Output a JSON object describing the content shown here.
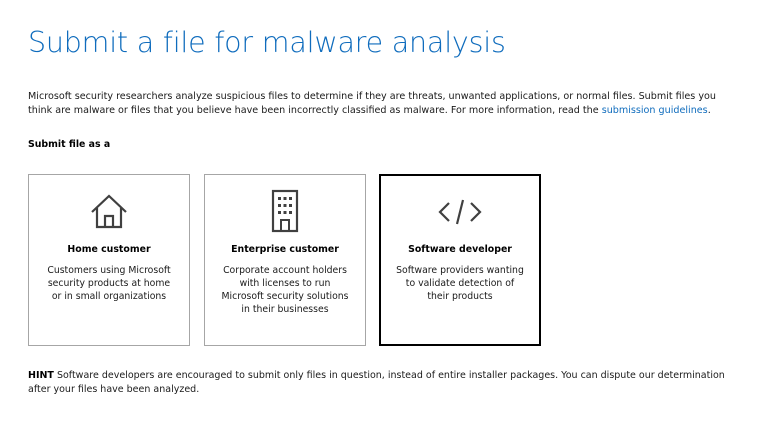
{
  "page": {
    "title": "Submit a file for malware analysis",
    "intro_text": "Microsoft security researchers analyze suspicious files to determine if they are threats, unwanted applications, or normal files. Submit files you think are malware or files that you believe have been incorrectly classified as malware. For more information, read the ",
    "intro_link": "submission guidelines",
    "intro_end": ".",
    "section_label": "Submit file as a"
  },
  "cards": [
    {
      "title": "Home customer",
      "description": "Customers using Microsoft security products at home or in small organizations",
      "icon": "home-icon",
      "selected": false
    },
    {
      "title": "Enterprise customer",
      "description": "Corporate account holders with licenses to run Microsoft security solutions in their businesses",
      "icon": "building-icon",
      "selected": false
    },
    {
      "title": "Software developer",
      "description": "Software providers wanting to validate detection of their products",
      "icon": "code-icon",
      "selected": true
    }
  ],
  "hint": {
    "label": "HINT",
    "text": " Software developers are encouraged to submit only files in question, instead of entire installer packages. You can dispute our determination after your files have been analyzed."
  },
  "colors": {
    "accent": "#0f6cbd",
    "card_border": "#a6a6a6",
    "icon": "#404040"
  }
}
